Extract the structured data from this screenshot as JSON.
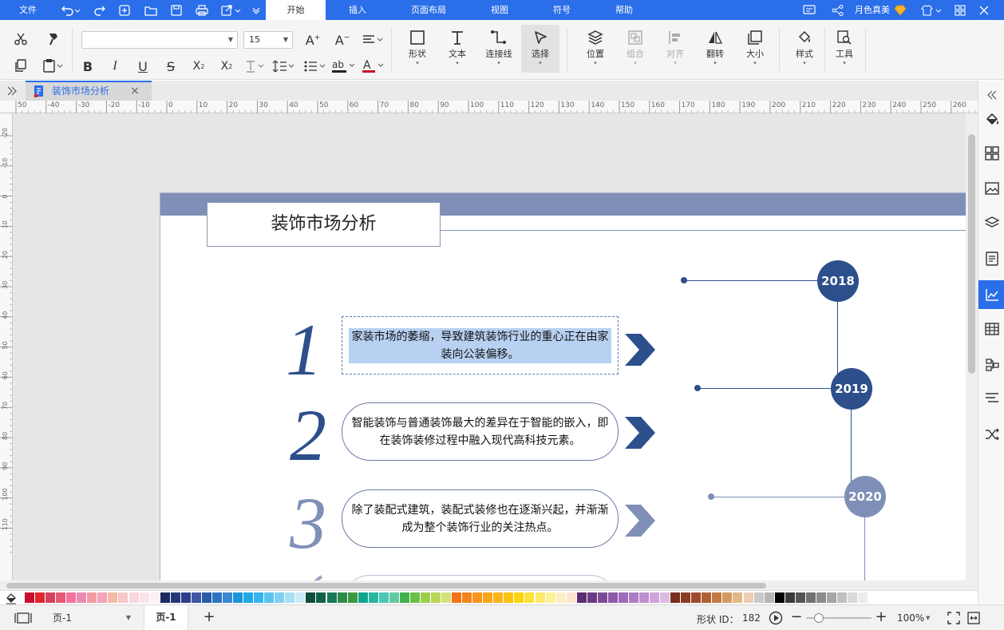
{
  "menubar": {
    "file": "文件",
    "tabs": [
      {
        "label": "开始",
        "active": true
      },
      {
        "label": "插入",
        "active": false
      },
      {
        "label": "页面布局",
        "active": false
      },
      {
        "label": "视图",
        "active": false
      },
      {
        "label": "符号",
        "active": false
      },
      {
        "label": "帮助",
        "active": false
      }
    ],
    "user": "月色真美"
  },
  "ribbon": {
    "font_name": "",
    "font_size": "15",
    "tools": {
      "shape": "形状",
      "text": "文本",
      "connector": "连接线",
      "select": "选择",
      "position": "位置",
      "group": "组合",
      "align": "对齐",
      "flip": "翻转",
      "size": "大小",
      "style": "样式",
      "tools": "工具"
    }
  },
  "document_tab": {
    "label": "装饰市场分析"
  },
  "ruler": {
    "h_ticks": [
      "50",
      "-40",
      "-30",
      "-20",
      "-10",
      "0",
      "10",
      "20",
      "30",
      "40",
      "50",
      "60",
      "70",
      "80",
      "90",
      "100",
      "110",
      "120",
      "130",
      "140",
      "150",
      "160",
      "170",
      "180",
      "190",
      "200",
      "210",
      "220",
      "230",
      "240",
      "250",
      "260"
    ],
    "v_ticks": [
      "-20",
      "-10",
      "0",
      "10",
      "20",
      "30",
      "40",
      "50",
      "60",
      "70",
      "80",
      "90",
      "100",
      "110"
    ]
  },
  "diagram": {
    "title": "装饰市场分析",
    "items": [
      {
        "num": "1",
        "text": "家装市场的萎缩，导致建筑装饰行业的重心正在由家装向公装偏移。"
      },
      {
        "num": "2",
        "text": "智能装饰与普通装饰最大的差异在于智能的嵌入，即在装饰装修过程中融入现代高科技元素。"
      },
      {
        "num": "3",
        "text": "除了装配式建筑，装配式装修也在逐渐兴起，并渐渐成为整个装饰行业的关注热点。"
      }
    ],
    "years": [
      "2018",
      "2019",
      "2020"
    ],
    "colors": {
      "dark": "#2d4f8c",
      "light": "#7f8fb7",
      "banner": "#7f8fb7"
    }
  },
  "palette": [
    "#c8102e",
    "#e0262f",
    "#d2425f",
    "#e85a73",
    "#f0739a",
    "#ec88b4",
    "#f29aa3",
    "#f3a4b6",
    "#f5b9a8",
    "#f7c8c5",
    "#f9d7dc",
    "#fbe3ea",
    "#fdeff2",
    "#1f2a5e",
    "#223a78",
    "#2e3e8f",
    "#3e56a6",
    "#2c5aa8",
    "#2f74c0",
    "#3b87d0",
    "#1b95d8",
    "#22a8e6",
    "#35b6ec",
    "#5ac4ef",
    "#7fd0f2",
    "#a8def5",
    "#cbe9f7",
    "#0f4d3c",
    "#126146",
    "#177a55",
    "#2c8a4a",
    "#3a9a3e",
    "#0fa58c",
    "#26b6a3",
    "#4cc7b5",
    "#63c9a0",
    "#3fb24a",
    "#6cbf45",
    "#9ccc4c",
    "#b8d65a",
    "#d4e27a",
    "#f2711c",
    "#f58320",
    "#f7931e",
    "#f9a51a",
    "#fbb416",
    "#fcc313",
    "#fdd30f",
    "#fde23a",
    "#fee96a",
    "#fef09a",
    "#fdeec4",
    "#fde5d0",
    "#5a2d72",
    "#6b3a85",
    "#7e4a98",
    "#8e5aa8",
    "#9d6bb8",
    "#ad7dc4",
    "#bd90cf",
    "#cda5da",
    "#ddbce4",
    "#7a2e1e",
    "#8c3a24",
    "#9e4a2a",
    "#b06034",
    "#c27a44",
    "#d49a62",
    "#e2b888",
    "#ead0b0",
    "#c9c9c9",
    "#b5b5b5",
    "#000000",
    "#3a3a3a",
    "#555555",
    "#707070",
    "#8a8a8a",
    "#a5a5a5",
    "#c0c0c0",
    "#dadada",
    "#ececec",
    "#ffffff"
  ],
  "statusbar": {
    "page_select": "页-1",
    "page_tab": "页-1",
    "shape_id_label": "形状 ID：",
    "shape_id": "182",
    "zoom": "100%",
    "zoom_level": 0.2
  }
}
